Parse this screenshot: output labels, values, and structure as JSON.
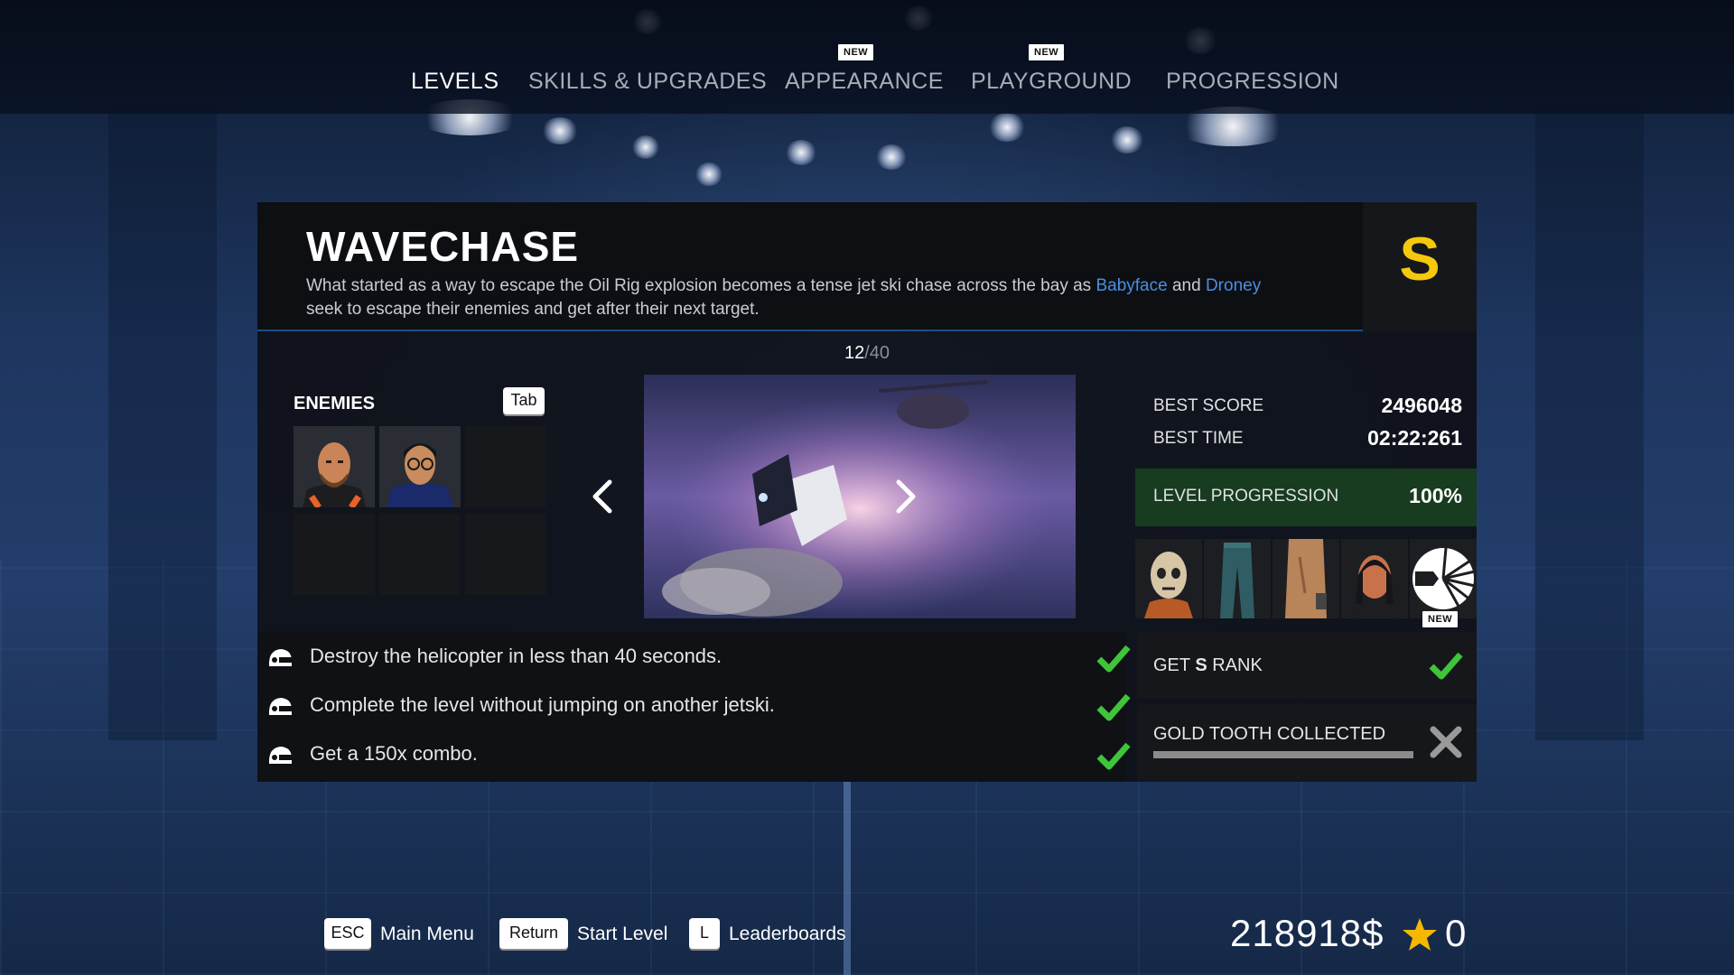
{
  "nav": {
    "tabs": [
      {
        "label": "LEVELS",
        "active": true
      },
      {
        "label": "SKILLS & UPGRADES"
      },
      {
        "label": "APPEARANCE",
        "badge": "NEW"
      },
      {
        "label": "PLAYGROUND",
        "badge": "NEW"
      },
      {
        "label": "PROGRESSION"
      }
    ]
  },
  "level": {
    "title": "WAVECHASE",
    "desc_line1_pre": "What started as a way to escape the Oil Rig explosion becomes a tense jet ski chase across the bay as ",
    "desc_name1": "Babyface",
    "desc_and": " and ",
    "desc_name2": "Droney",
    "desc_line2": "seek to escape their enemies and get after their next target.",
    "rank": "S",
    "index": "12",
    "total": "/40"
  },
  "enemies": {
    "title": "ENEMIES",
    "tab_key": "Tab"
  },
  "stats": {
    "best_score_label": "BEST SCORE",
    "best_score": "2496048",
    "best_time_label": "BEST TIME",
    "best_time": "02:22:261",
    "progression_label": "LEVEL PROGRESSION",
    "progression_value": "100%",
    "reward_new_badge": "NEW"
  },
  "objectives": [
    {
      "text": "Destroy the helicopter in less than 40 seconds.",
      "done": true
    },
    {
      "text": "Complete the level without jumping on another jetski.",
      "done": true
    },
    {
      "text": "Get a 150x combo.",
      "done": true
    }
  ],
  "goals": {
    "rank_pre": "GET ",
    "rank_letter": "S",
    "rank_post": " RANK",
    "rank_done": true,
    "gold_tooth_label": "GOLD TOOTH COLLECTED",
    "gold_tooth_done": false
  },
  "footer": {
    "esc_key": "ESC",
    "esc_label": "Main Menu",
    "return_key": "Return",
    "return_label": "Start Level",
    "l_key": "L",
    "l_label": "Leaderboards",
    "money": "218918$",
    "stars": "0"
  },
  "colors": {
    "accent_blue": "#4a8fe0",
    "rank_yellow": "#f5c80b",
    "check_green": "#3fc43a",
    "progress_green": "#173c1f"
  }
}
